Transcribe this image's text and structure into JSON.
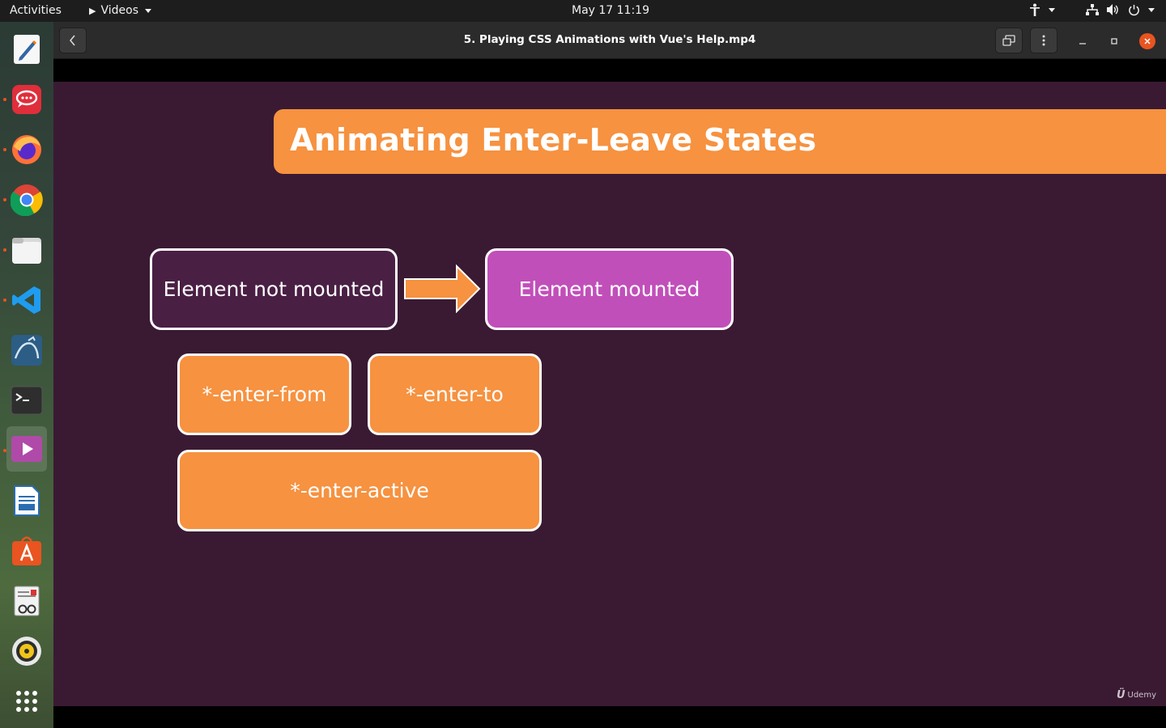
{
  "topbar": {
    "activities": "Activities",
    "app_name": "Videos",
    "clock": "May 17  11:19"
  },
  "dock": {
    "items": [
      {
        "name": "text-editor"
      },
      {
        "name": "rocketchat"
      },
      {
        "name": "firefox"
      },
      {
        "name": "chrome"
      },
      {
        "name": "files"
      },
      {
        "name": "vscode"
      },
      {
        "name": "mysql-workbench"
      },
      {
        "name": "terminal"
      },
      {
        "name": "videos"
      },
      {
        "name": "libreoffice-writer"
      },
      {
        "name": "ubuntu-software"
      },
      {
        "name": "document-viewer"
      },
      {
        "name": "rhythmbox"
      },
      {
        "name": "show-applications"
      }
    ]
  },
  "window": {
    "title": "5. Playing CSS Animations with Vue's Help.mp4"
  },
  "slide": {
    "title": "Animating Enter-Leave States",
    "box_not_mounted": "Element not mounted",
    "box_mounted": "Element mounted",
    "box_enter_from": "*-enter-from",
    "box_enter_to": "*-enter-to",
    "box_enter_active": "*-enter-active",
    "watermark": "Udemy",
    "colors": {
      "background": "#3a1a33",
      "orange": "#f69240",
      "purple": "#c14fba",
      "dark_box": "#4a1f44"
    }
  }
}
